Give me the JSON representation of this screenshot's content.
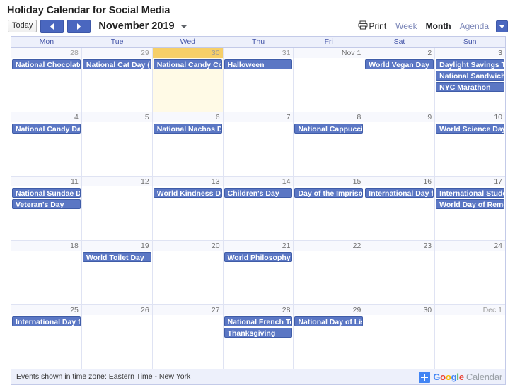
{
  "page": {
    "title": "Holiday Calendar for Social Media"
  },
  "toolbar": {
    "today_label": "Today",
    "prev_icon": "chevron-left-icon",
    "next_icon": "chevron-right-icon",
    "month_label": "November 2019",
    "month_caret_icon": "chevron-down-icon",
    "print_label": "Print",
    "print_icon": "printer-icon",
    "views": [
      {
        "label": "Week",
        "active": false
      },
      {
        "label": "Month",
        "active": true
      },
      {
        "label": "Agenda",
        "active": false
      }
    ],
    "agenda_caret_icon": "chevron-down-icon"
  },
  "calendar": {
    "day_headers": [
      "Mon",
      "Tue",
      "Wed",
      "Thu",
      "Fri",
      "Sat",
      "Sun"
    ],
    "accent_color": "#5b77c4",
    "today_color": "#f6cf68",
    "weeks": [
      [
        {
          "num": "28",
          "other": true,
          "today": false,
          "events": [
            "National Chocolate"
          ]
        },
        {
          "num": "29",
          "other": true,
          "today": false,
          "events": [
            "National Cat Day ("
          ]
        },
        {
          "num": "30",
          "other": true,
          "today": true,
          "events": [
            "National Candy Co"
          ]
        },
        {
          "num": "31",
          "other": true,
          "today": false,
          "events": [
            "Halloween"
          ]
        },
        {
          "num": "Nov 1",
          "other": false,
          "today": false,
          "events": []
        },
        {
          "num": "2",
          "other": false,
          "today": false,
          "events": [
            "World Vegan Day"
          ]
        },
        {
          "num": "3",
          "other": false,
          "today": false,
          "events": [
            "Daylight Savings T",
            "National Sandwich",
            "NYC Marathon"
          ]
        }
      ],
      [
        {
          "num": "4",
          "other": false,
          "today": false,
          "events": [
            "National Candy Da"
          ]
        },
        {
          "num": "5",
          "other": false,
          "today": false,
          "events": []
        },
        {
          "num": "6",
          "other": false,
          "today": false,
          "events": [
            "National Nachos Da"
          ]
        },
        {
          "num": "7",
          "other": false,
          "today": false,
          "events": []
        },
        {
          "num": "8",
          "other": false,
          "today": false,
          "events": [
            "National Cappuccin"
          ]
        },
        {
          "num": "9",
          "other": false,
          "today": false,
          "events": []
        },
        {
          "num": "10",
          "other": false,
          "today": false,
          "events": [
            "World Science Day"
          ]
        }
      ],
      [
        {
          "num": "11",
          "other": false,
          "today": false,
          "events": [
            "National Sundae D",
            "Veteran's Day"
          ]
        },
        {
          "num": "12",
          "other": false,
          "today": false,
          "events": []
        },
        {
          "num": "13",
          "other": false,
          "today": false,
          "events": [
            "World Kindness Da"
          ]
        },
        {
          "num": "14",
          "other": false,
          "today": false,
          "events": [
            "Children's Day"
          ]
        },
        {
          "num": "15",
          "other": false,
          "today": false,
          "events": [
            "Day of the Impriso"
          ]
        },
        {
          "num": "16",
          "other": false,
          "today": false,
          "events": [
            "International Day f"
          ]
        },
        {
          "num": "17",
          "other": false,
          "today": false,
          "events": [
            "International Stude",
            "World Day of Reme"
          ]
        }
      ],
      [
        {
          "num": "18",
          "other": false,
          "today": false,
          "events": []
        },
        {
          "num": "19",
          "other": false,
          "today": false,
          "events": [
            "World Toilet Day"
          ]
        },
        {
          "num": "20",
          "other": false,
          "today": false,
          "events": []
        },
        {
          "num": "21",
          "other": false,
          "today": false,
          "events": [
            "World Philosophy D"
          ]
        },
        {
          "num": "22",
          "other": false,
          "today": false,
          "events": []
        },
        {
          "num": "23",
          "other": false,
          "today": false,
          "events": []
        },
        {
          "num": "24",
          "other": false,
          "today": false,
          "events": []
        }
      ],
      [
        {
          "num": "25",
          "other": false,
          "today": false,
          "events": [
            "International Day f"
          ]
        },
        {
          "num": "26",
          "other": false,
          "today": false,
          "events": []
        },
        {
          "num": "27",
          "other": false,
          "today": false,
          "events": []
        },
        {
          "num": "28",
          "other": false,
          "today": false,
          "events": [
            "National French To",
            "Thanksgiving"
          ]
        },
        {
          "num": "29",
          "other": false,
          "today": false,
          "events": [
            "National Day of Lis"
          ]
        },
        {
          "num": "30",
          "other": false,
          "today": false,
          "events": []
        },
        {
          "num": "Dec 1",
          "other": true,
          "today": false,
          "events": []
        }
      ]
    ]
  },
  "footer": {
    "timezone_note": "Events shown in time zone: Eastern Time - New York",
    "badge": {
      "plus_icon": "plus-icon",
      "brand": "Google",
      "product": "Calendar"
    }
  }
}
